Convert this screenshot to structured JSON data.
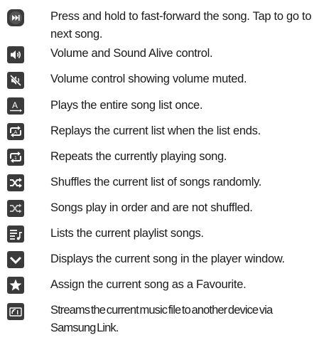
{
  "items": [
    {
      "icon": "skip-next-icon",
      "text": "Press and hold to fast-forward the song. Tap to go to next song."
    },
    {
      "icon": "volume-icon",
      "text": "Volume and Sound Alive control."
    },
    {
      "icon": "volume-muted-icon",
      "text": "Volume control showing volume muted."
    },
    {
      "icon": "play-all-once-icon",
      "text": "Plays the entire song list once."
    },
    {
      "icon": "repeat-all-icon",
      "text": "Replays the current list when the list ends."
    },
    {
      "icon": "repeat-one-icon",
      "text": "Repeats the currently playing song."
    },
    {
      "icon": "shuffle-on-icon",
      "text": "Shuffles the current list of songs randomly."
    },
    {
      "icon": "shuffle-off-icon",
      "text": "Songs play in order and are not shuffled."
    },
    {
      "icon": "playlist-icon",
      "text": "Lists the current playlist songs."
    },
    {
      "icon": "chevron-down-icon",
      "text": "Displays the current song in the player window."
    },
    {
      "icon": "star-icon",
      "text": "Assign the current song as a Favourite."
    },
    {
      "icon": "stream-device-icon",
      "text": "Streams the current music file to another device via Samsung Link."
    }
  ],
  "colors": {
    "icon_background": "#3b3b3b",
    "icon_foreground": "#ffffff",
    "text": "#1a1a1a"
  }
}
